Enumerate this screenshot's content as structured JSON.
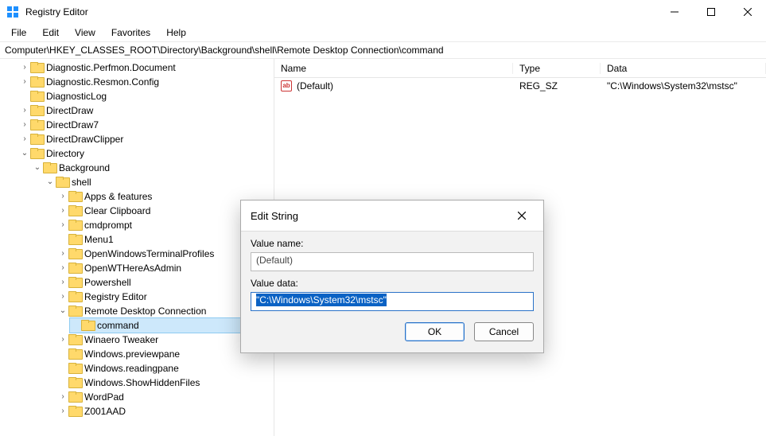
{
  "window": {
    "title": "Registry Editor",
    "minimize": "–",
    "maximize": "□",
    "close": "✕"
  },
  "menu": {
    "items": [
      "File",
      "Edit",
      "View",
      "Favorites",
      "Help"
    ]
  },
  "address": "Computer\\HKEY_CLASSES_ROOT\\Directory\\Background\\shell\\Remote Desktop Connection\\command",
  "tree": {
    "top": [
      {
        "label": "Diagnostic.Perfmon.Document"
      },
      {
        "label": "Diagnostic.Resmon.Config"
      },
      {
        "label": "DiagnosticLog"
      },
      {
        "label": "DirectDraw"
      },
      {
        "label": "DirectDraw7"
      },
      {
        "label": "DirectDrawClipper"
      }
    ],
    "directory": {
      "label": "Directory"
    },
    "background": {
      "label": "Background"
    },
    "shell": {
      "label": "shell"
    },
    "shell_items": [
      {
        "label": "Apps & features"
      },
      {
        "label": "Clear Clipboard"
      },
      {
        "label": "cmdprompt"
      },
      {
        "label": "Menu1"
      },
      {
        "label": "OpenWindowsTerminalProfiles"
      },
      {
        "label": "OpenWTHereAsAdmin"
      },
      {
        "label": "Powershell"
      },
      {
        "label": "Registry Editor"
      }
    ],
    "rdc": {
      "label": "Remote Desktop Connection"
    },
    "command": {
      "label": "command"
    },
    "shell_after": [
      {
        "label": "Winaero Tweaker"
      },
      {
        "label": "Windows.previewpane"
      },
      {
        "label": "Windows.readingpane"
      },
      {
        "label": "Windows.ShowHiddenFiles"
      },
      {
        "label": "WordPad"
      },
      {
        "label": "Z001AAD"
      }
    ]
  },
  "list": {
    "headers": {
      "name": "Name",
      "type": "Type",
      "data": "Data"
    },
    "rows": [
      {
        "name": "(Default)",
        "type": "REG_SZ",
        "data": "\"C:\\Windows\\System32\\mstsc\""
      }
    ]
  },
  "dialog": {
    "title": "Edit String",
    "value_name_label": "Value name:",
    "value_name": "(Default)",
    "value_data_label": "Value data:",
    "value_data": "\"C:\\Windows\\System32\\mstsc\"",
    "ok": "OK",
    "cancel": "Cancel"
  }
}
